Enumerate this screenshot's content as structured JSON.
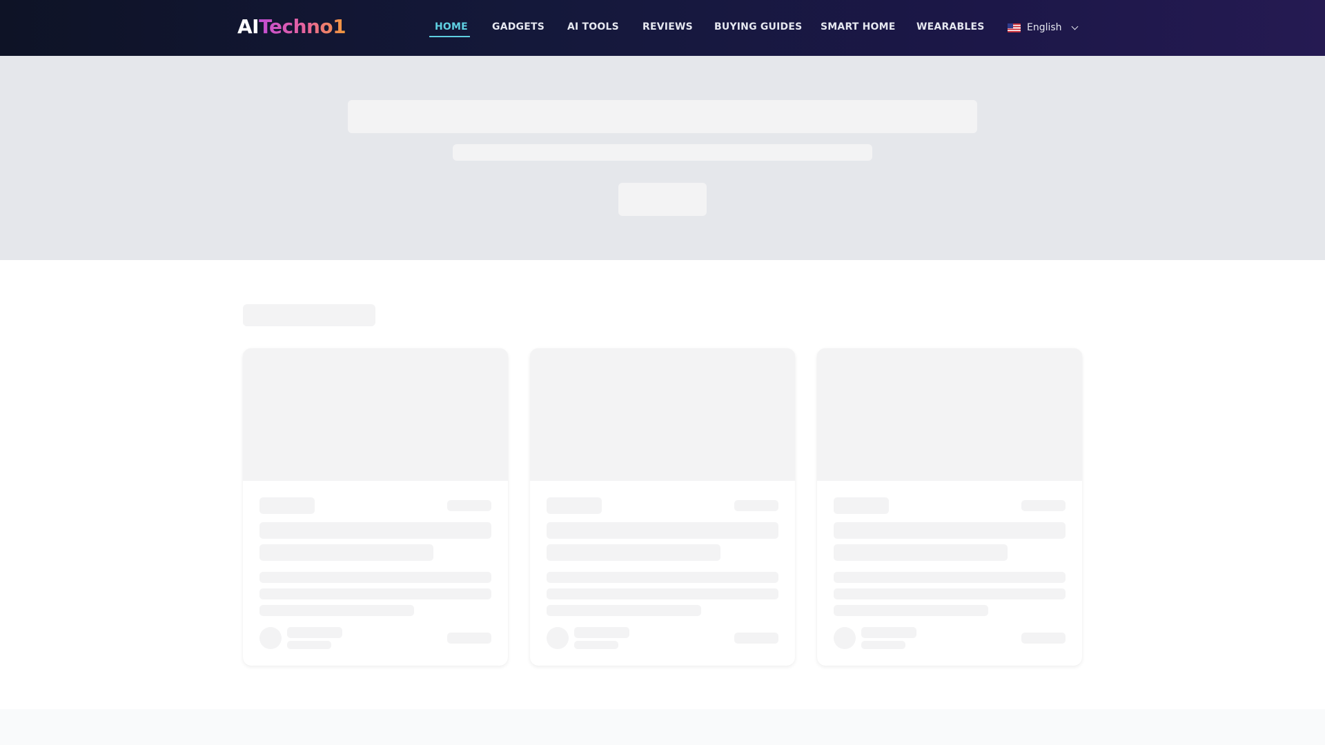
{
  "header": {
    "logo_ai": "AI",
    "logo_brand": "Techno1",
    "nav": [
      {
        "label": "HOME",
        "active": true
      },
      {
        "label": "GADGETS",
        "active": false
      },
      {
        "label": "AI TOOLS",
        "active": false
      },
      {
        "label": "REVIEWS",
        "active": false
      },
      {
        "label": "BUYING GUIDES",
        "active": false
      },
      {
        "label": "SMART HOME",
        "active": false
      },
      {
        "label": "WEARABLES",
        "active": false
      }
    ],
    "language": {
      "flag_icon": "us-flag-icon",
      "label": "English",
      "dropdown_icon": "chevron-down-icon"
    }
  },
  "state": "loading-skeleton",
  "colors": {
    "header_bg": "#14183a",
    "nav_active": "#5fd0e2",
    "nav_text": "#e6e8f0",
    "skeleton": "#f3f3f4",
    "hero_bg": "#e5e7eb",
    "logo_gradient_start": "#c24dd6",
    "logo_gradient_end": "#f39a3a"
  },
  "cards_count": 3
}
